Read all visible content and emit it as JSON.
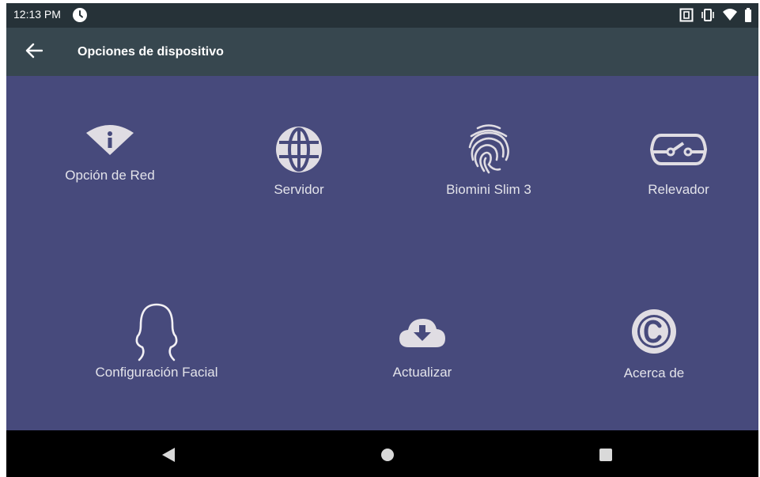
{
  "status_bar": {
    "time": "12:13 PM",
    "icons": [
      "clock-icon",
      "nfc-icon",
      "vibrate-icon",
      "wifi-icon",
      "battery-icon"
    ]
  },
  "app_bar": {
    "title": "Opciones de dispositivo",
    "back_icon": "arrow-back-icon"
  },
  "options": [
    {
      "label": "Opción de Red",
      "icon": "wifi-info-icon"
    },
    {
      "label": "Servidor",
      "icon": "globe-icon"
    },
    {
      "label": "Biomini Slim 3",
      "icon": "fingerprint-icon"
    },
    {
      "label": "Relevador",
      "icon": "relay-switch-icon"
    },
    {
      "label": "Configuración Facial",
      "icon": "face-outline-icon"
    },
    {
      "label": "Actualizar",
      "icon": "cloud-download-icon"
    },
    {
      "label": "Acerca de",
      "icon": "copyright-icon"
    }
  ],
  "nav_bar": [
    "back-triangle-icon",
    "home-circle-icon",
    "recents-square-icon"
  ],
  "colors": {
    "status_bar": "#263238",
    "app_bar": "#37474f",
    "content_bg": "#474a7c",
    "icon": "#e0dde3",
    "nav_bar": "#000000"
  }
}
